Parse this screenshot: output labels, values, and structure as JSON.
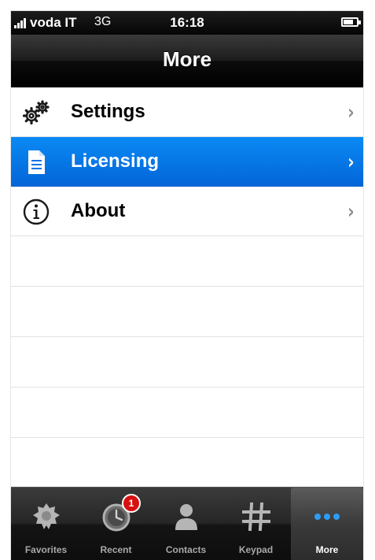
{
  "status_bar": {
    "carrier": "voda IT",
    "network": "3G",
    "time": "16:18"
  },
  "nav": {
    "title": "More"
  },
  "menu": {
    "items": [
      {
        "label": "Settings",
        "icon": "gear-icon",
        "selected": false
      },
      {
        "label": "Licensing",
        "icon": "document-icon",
        "selected": true
      },
      {
        "label": "About",
        "icon": "info-icon",
        "selected": false
      }
    ]
  },
  "tab_bar": {
    "tabs": [
      {
        "label": "Favorites",
        "icon": "star-icon",
        "active": false
      },
      {
        "label": "Recent",
        "icon": "clock-icon",
        "active": false,
        "badge": "1"
      },
      {
        "label": "Contacts",
        "icon": "person-icon",
        "active": false
      },
      {
        "label": "Keypad",
        "icon": "keypad-icon",
        "active": false
      },
      {
        "label": "More",
        "icon": "more-icon",
        "active": true
      }
    ]
  },
  "colors": {
    "selection": "#0a7bea",
    "bar_background": "#111111",
    "separator": "#e0e0e0"
  }
}
